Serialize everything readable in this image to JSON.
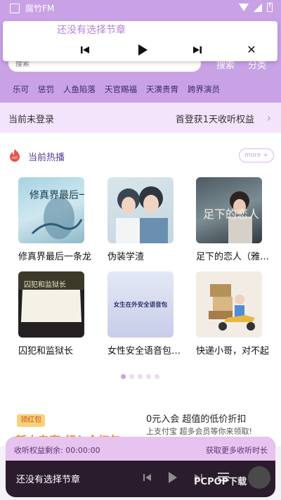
{
  "status_bar": {
    "app_name": "腐竹FM"
  },
  "float_player": {
    "title": "还没有选择节章"
  },
  "header": {
    "search_placeholder": "搜索",
    "search_label": "搜索",
    "category_label": "分类",
    "tags": [
      "乐可",
      "惩罚",
      "人鱼陷落",
      "天官赐福",
      "天潢贵胄",
      "跨界演员"
    ]
  },
  "login_strip": {
    "status": "当前未登录",
    "offer": "首登获1天收听权益"
  },
  "hot": {
    "title": "当前热播",
    "more_label": "more +",
    "items": [
      {
        "title": "修真界最后一条龙",
        "cover_text": "修真界最后一条龙"
      },
      {
        "title": "伪装学渣"
      },
      {
        "title": "足下的恋人（雅策…",
        "cover_text": "足下的恋人"
      },
      {
        "title": "囚犯和监狱长",
        "cover_text": "囚犯和监狱长"
      },
      {
        "title": "女性安全语音包（…",
        "cover_text": "女生在外安全语音包"
      },
      {
        "title": "快递小哥，对不起"
      }
    ],
    "page_count": 5,
    "active_page": 0
  },
  "promo": {
    "badge": "领红包",
    "title": "0元入会 超值的低价折扣",
    "subtitle": "上支付宝 超多会员等你来领取!",
    "partial_text": "新人专享 领入会红包"
  },
  "bottom_player": {
    "remaining": "收听权益剩余: 00:00:00",
    "more_time": "获取更多收听时长",
    "title": "还没有选择节章"
  },
  "watermark": "PCPOP下载",
  "colors": {
    "primary": "#c9a2e6",
    "login_strip": "#f4e4fb",
    "player_bg": "#2b1c2d"
  }
}
